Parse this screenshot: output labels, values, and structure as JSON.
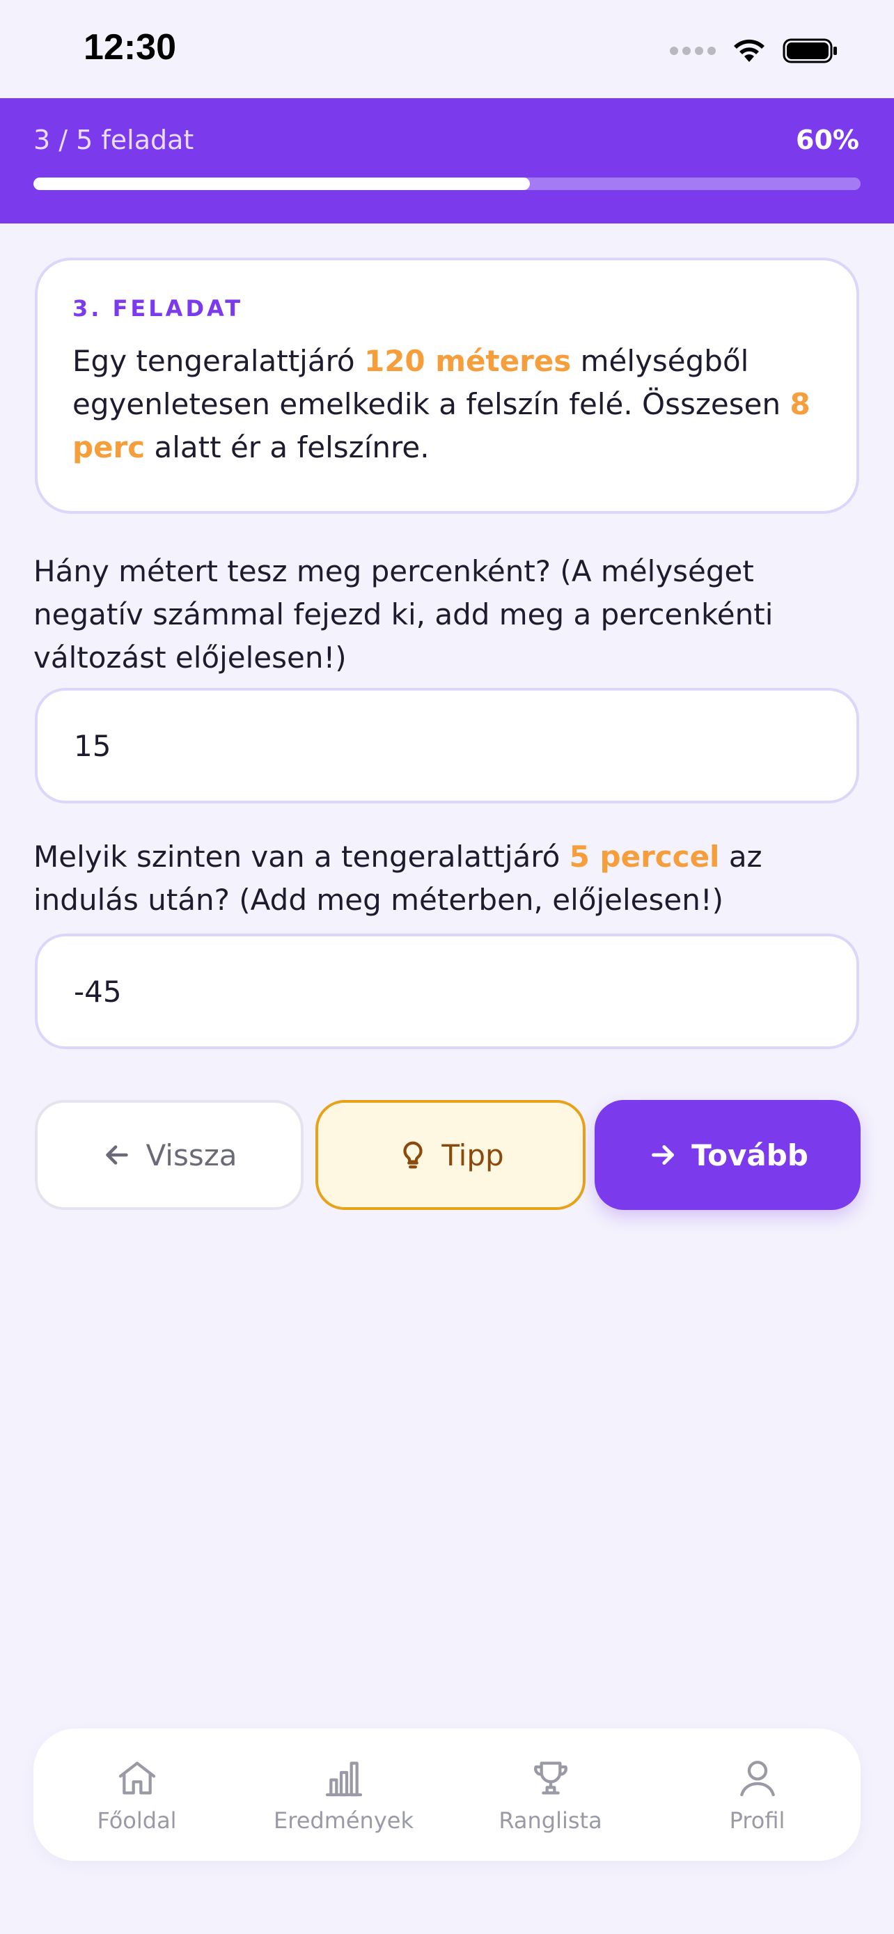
{
  "status_bar": {
    "time": "12:30"
  },
  "header": {
    "progress_label": "3 / 5 feladat",
    "progress_percent": "60%",
    "progress_fraction": 0.6
  },
  "task": {
    "label": "3. FELADAT",
    "text_parts": {
      "p1": "Egy tengeralattjáró ",
      "h1": "120 méteres",
      "p2": " mélységből egyenletesen emelkedik a felszín felé. Összesen ",
      "h2": "8 perc",
      "p3": " alatt ér a felszínre."
    }
  },
  "questions": {
    "q1": "Hány métert tesz meg percenként? (A mélységet negatív számmal fejezd ki, add meg a percenkénti változást előjelesen!)",
    "a1": "15",
    "q2_parts": {
      "p1": "Melyik szinten van a tengeralattjáró ",
      "h1": "5 perccel",
      "p2": " az indulás után? (Add meg méterben, előjelesen!)"
    },
    "a2": "-45"
  },
  "buttons": {
    "back": "Vissza",
    "tip": "Tipp",
    "next": "Tovább"
  },
  "nav": {
    "home": "Főoldal",
    "results": "Eredmények",
    "leaderboard": "Ranglista",
    "profile": "Profil"
  },
  "colors": {
    "accent": "#7C3AED",
    "highlight": "#F59E3B",
    "tip_border": "#E8A21A"
  }
}
